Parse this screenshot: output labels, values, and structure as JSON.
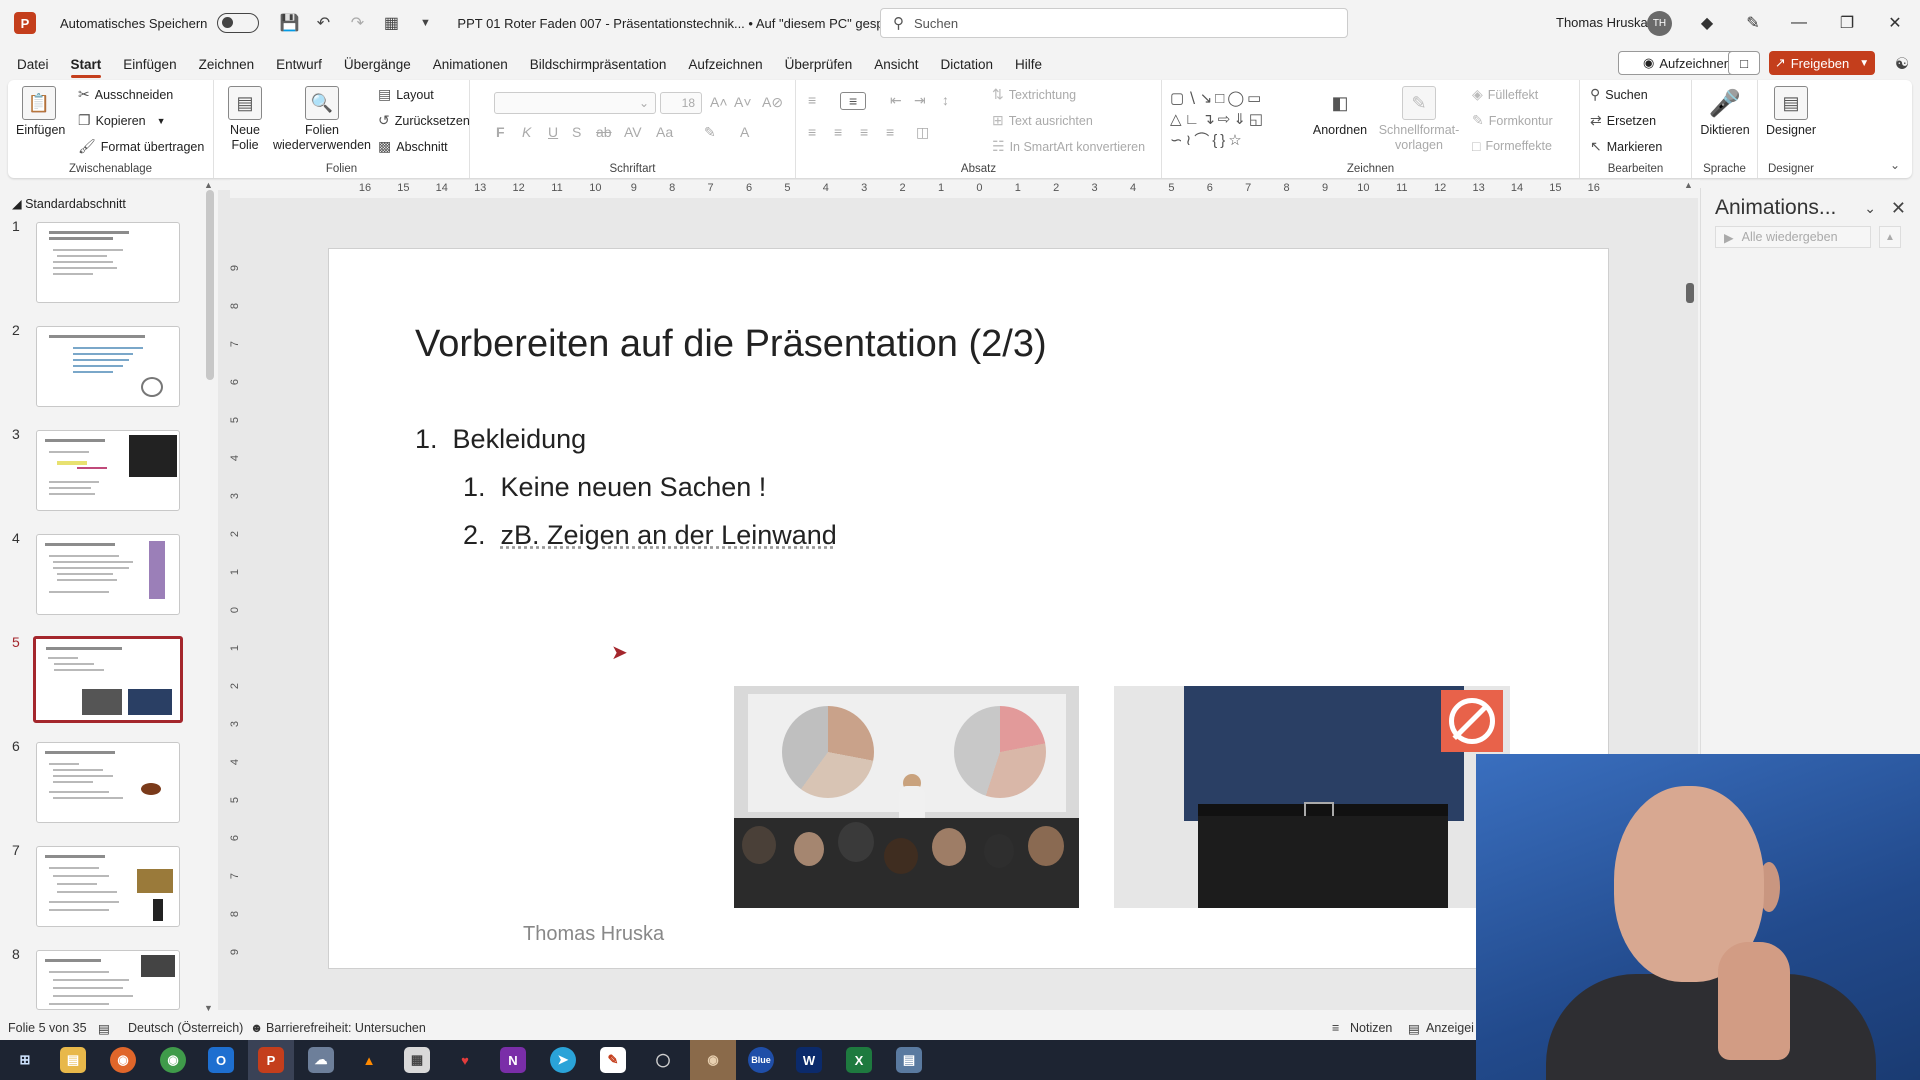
{
  "titlebar": {
    "autosave_label": "Automatisches Speichern",
    "doc_title": "PPT 01 Roter Faden 007 - Präsentationstechnik...  •  Auf \"diesem PC\" gespeichert",
    "search_placeholder": "Suchen",
    "user_name": "Thomas Hruska",
    "user_initials": "TH"
  },
  "menu": {
    "tabs": [
      "Datei",
      "Start",
      "Einfügen",
      "Zeichnen",
      "Entwurf",
      "Übergänge",
      "Animationen",
      "Bildschirmpräsentation",
      "Aufzeichnen",
      "Überprüfen",
      "Ansicht",
      "Dictation",
      "Hilfe"
    ],
    "active_tab": "Start",
    "record_label": "Aufzeichnen",
    "share_label": "Freigeben"
  },
  "ribbon": {
    "clipboard": {
      "label": "Zwischenablage",
      "paste": "Einfügen",
      "cut": "Ausschneiden",
      "copy": "Kopieren",
      "format_painter": "Format übertragen"
    },
    "slides": {
      "label": "Folien",
      "new_slide_1": "Neue",
      "new_slide_2": "Folie",
      "reuse_1": "Folien",
      "reuse_2": "wiederverwenden",
      "layout": "Layout",
      "reset": "Zurücksetzen",
      "section": "Abschnitt"
    },
    "font": {
      "label": "Schriftart",
      "size": "18"
    },
    "paragraph": {
      "label": "Absatz",
      "text_direction": "Textrichtung",
      "align_text": "Text ausrichten",
      "smartart": "In SmartArt konvertieren"
    },
    "drawing": {
      "label": "Zeichnen",
      "arrange": "Anordnen",
      "quick_styles_1": "Schnellformat-",
      "quick_styles_2": "vorlagen",
      "fill": "Fülleffekt",
      "outline": "Formkontur",
      "effects": "Formeffekte"
    },
    "editing": {
      "label": "Bearbeiten",
      "find": "Suchen",
      "replace": "Ersetzen",
      "select": "Markieren"
    },
    "voice": {
      "label": "Sprache",
      "dictate": "Diktieren"
    },
    "designer": {
      "label": "Designer",
      "designer": "Designer"
    }
  },
  "slide_panel": {
    "section": "Standardabschnitt",
    "thumbnails": [
      "1",
      "2",
      "3",
      "4",
      "5",
      "6",
      "7",
      "8"
    ],
    "selected": 5
  },
  "ruler": {
    "h_ticks": [
      "16",
      "15",
      "14",
      "13",
      "12",
      "11",
      "10",
      "9",
      "8",
      "7",
      "6",
      "5",
      "4",
      "3",
      "2",
      "1",
      "0",
      "1",
      "2",
      "3",
      "4",
      "5",
      "6",
      "7",
      "8",
      "9",
      "10",
      "11",
      "12",
      "13",
      "14",
      "15",
      "16"
    ],
    "v_ticks": [
      "9",
      "8",
      "7",
      "6",
      "5",
      "4",
      "3",
      "2",
      "1",
      "0",
      "1",
      "2",
      "3",
      "4",
      "5",
      "6",
      "7",
      "8",
      "9"
    ]
  },
  "slide": {
    "title": "Vorbereiten auf die Präsentation (2/3)",
    "item1_num": "1.",
    "item1": "Bekleidung",
    "sub1_num": "1.",
    "sub1": "Keine neuen Sachen !",
    "sub2_num": "2.",
    "sub2": "zB. Zeigen an der Leinwand",
    "footer": "Thomas Hruska"
  },
  "animation_pane": {
    "title": "Animations...",
    "play_all": "Alle wiedergeben"
  },
  "statusbar": {
    "slide_count": "Folie 5 von 35",
    "language": "Deutsch (Österreich)",
    "accessibility": "Barrierefreiheit: Untersuchen",
    "notes": "Notizen",
    "display": "Anzeigei"
  },
  "colors": {
    "accent": "#c43e1c",
    "selected_thumb": "#a4262c",
    "taskbar": "#1d2432"
  }
}
